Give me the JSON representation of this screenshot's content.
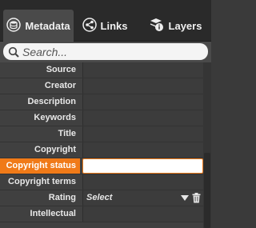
{
  "tabs": [
    {
      "label": "Metadata",
      "icon": "database-icon",
      "active": true
    },
    {
      "label": "Links",
      "icon": "share-icon",
      "active": false
    },
    {
      "label": "Layers",
      "icon": "layers-icon",
      "active": false
    }
  ],
  "search": {
    "placeholder": "Search..."
  },
  "fields": [
    {
      "label": "Source",
      "value": ""
    },
    {
      "label": "Creator",
      "value": ""
    },
    {
      "label": "Description",
      "value": ""
    },
    {
      "label": "Keywords",
      "value": ""
    },
    {
      "label": "Title",
      "value": ""
    },
    {
      "label": "Copyright",
      "value": ""
    },
    {
      "label": "Copyright status",
      "value": "",
      "highlight": true
    },
    {
      "label": "Copyright terms",
      "value": ""
    },
    {
      "label": "Rating",
      "value": "Select",
      "type": "select"
    },
    {
      "label": "Intellectual",
      "value": ""
    }
  ],
  "colors": {
    "accent": "#f07a18",
    "panel": "#404040",
    "tabbar": "#2a2a2a"
  }
}
